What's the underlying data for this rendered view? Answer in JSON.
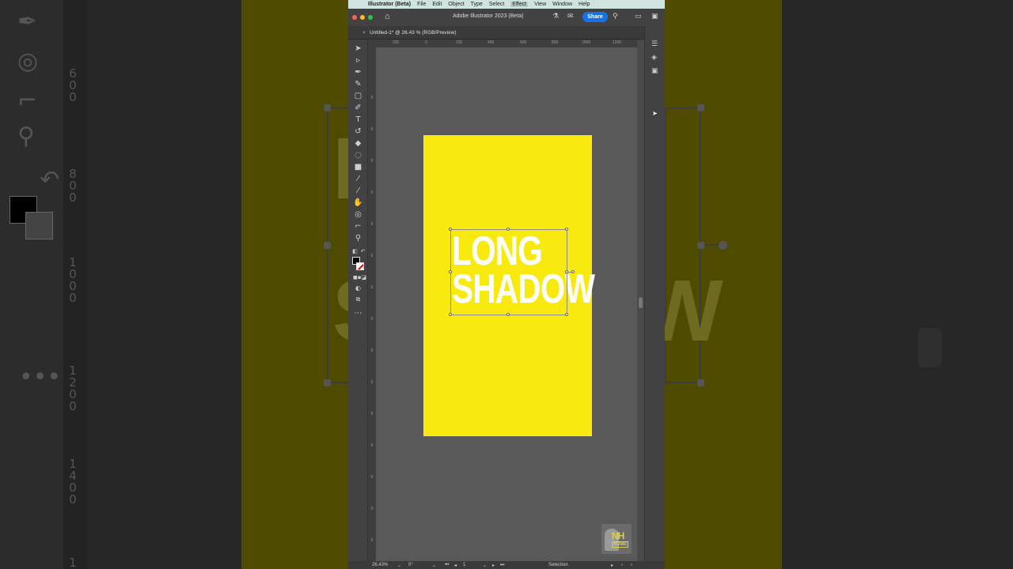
{
  "menubar": {
    "items": [
      {
        "label": "Illustrator (Beta)"
      },
      {
        "label": "File"
      },
      {
        "label": "Edit"
      },
      {
        "label": "Object"
      },
      {
        "label": "Type"
      },
      {
        "label": "Select"
      },
      {
        "label": "Effect"
      },
      {
        "label": "View"
      },
      {
        "label": "Window"
      },
      {
        "label": "Help"
      }
    ]
  },
  "titlebar": {
    "title": "Adobe Illustrator 2023 (Beta)",
    "share_label": "Share"
  },
  "document_tab": {
    "title": "Untitled-1* @ 26.43 % (RGB/Preview)",
    "close": "×"
  },
  "rulers": {
    "horizontal": [
      "200",
      "0",
      "200",
      "400",
      "600",
      "800",
      "1000",
      "1200"
    ],
    "vertical": [
      "0",
      "0",
      "0",
      "0",
      "0",
      "0",
      "0",
      "0",
      "0",
      "0",
      "0",
      "0",
      "0",
      "0",
      "0"
    ]
  },
  "artboard": {
    "line1": "LONG",
    "line2": "SHADOW"
  },
  "statusbar": {
    "zoom": "26.43%",
    "rotation": "0°",
    "artboard_index": "1",
    "tool": "Selection"
  },
  "watermark": {
    "text": "NH",
    "sub": "M2ME"
  },
  "background": {
    "ruler_labels": [
      "6",
      "0",
      "0",
      "8",
      "0",
      "0",
      "1",
      "0",
      "0",
      "0",
      "1",
      "2",
      "0",
      "0",
      "1",
      "4",
      "0",
      "0",
      "1"
    ],
    "letters": [
      "L",
      "S",
      "W"
    ]
  },
  "colors": {
    "artboard": "#f8ea0e",
    "share": "#1473e6",
    "menubar": "#cfe3e0"
  }
}
